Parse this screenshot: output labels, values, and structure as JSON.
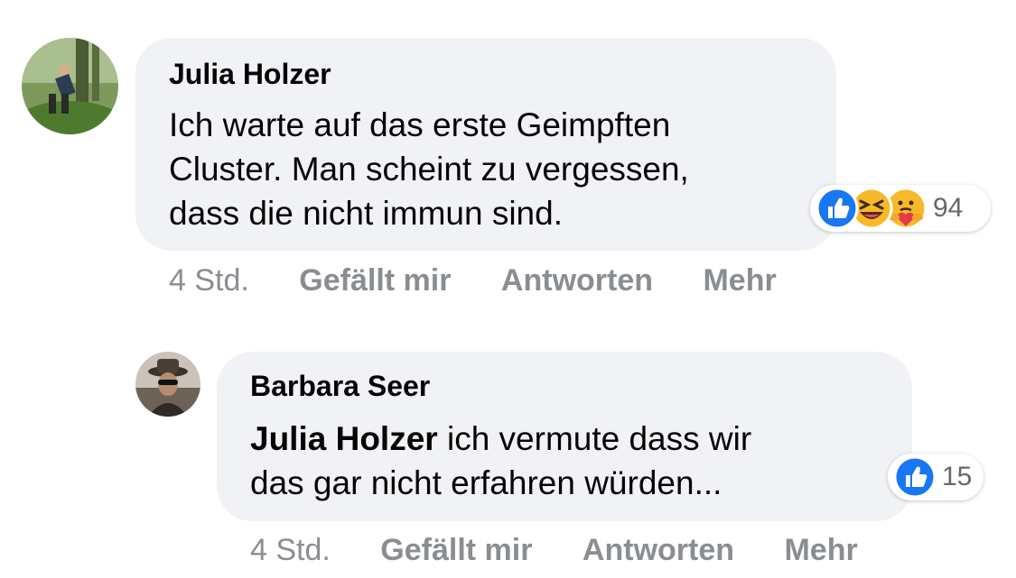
{
  "comments": [
    {
      "author": "Julia Holzer",
      "text_lines": [
        "Ich warte auf das erste Geimpften",
        "Cluster. Man scheint zu vergessen,",
        "dass die nicht immun sind."
      ],
      "time": "4 Std.",
      "like_label": "Gefällt mir",
      "reply_label": "Antworten",
      "more_label": "Mehr",
      "reaction_icons": [
        "like-icon",
        "haha-icon",
        "care-icon"
      ],
      "reaction_count": "94"
    },
    {
      "author": "Barbara Seer",
      "mention": "Julia Holzer",
      "text_after_mention": " ich vermute dass wir",
      "text_line2": "das gar nicht erfahren würden...",
      "time": "4 Std.",
      "like_label": "Gefällt mir",
      "reply_label": "Antworten",
      "more_label": "Mehr",
      "reaction_icons": [
        "like-icon"
      ],
      "reaction_count": "15"
    }
  ],
  "colors": {
    "bubble": "#f0f2f5",
    "meta_text": "#8a8d91",
    "like_blue": "#1877f2",
    "haha_yellow": "#f7b928"
  }
}
